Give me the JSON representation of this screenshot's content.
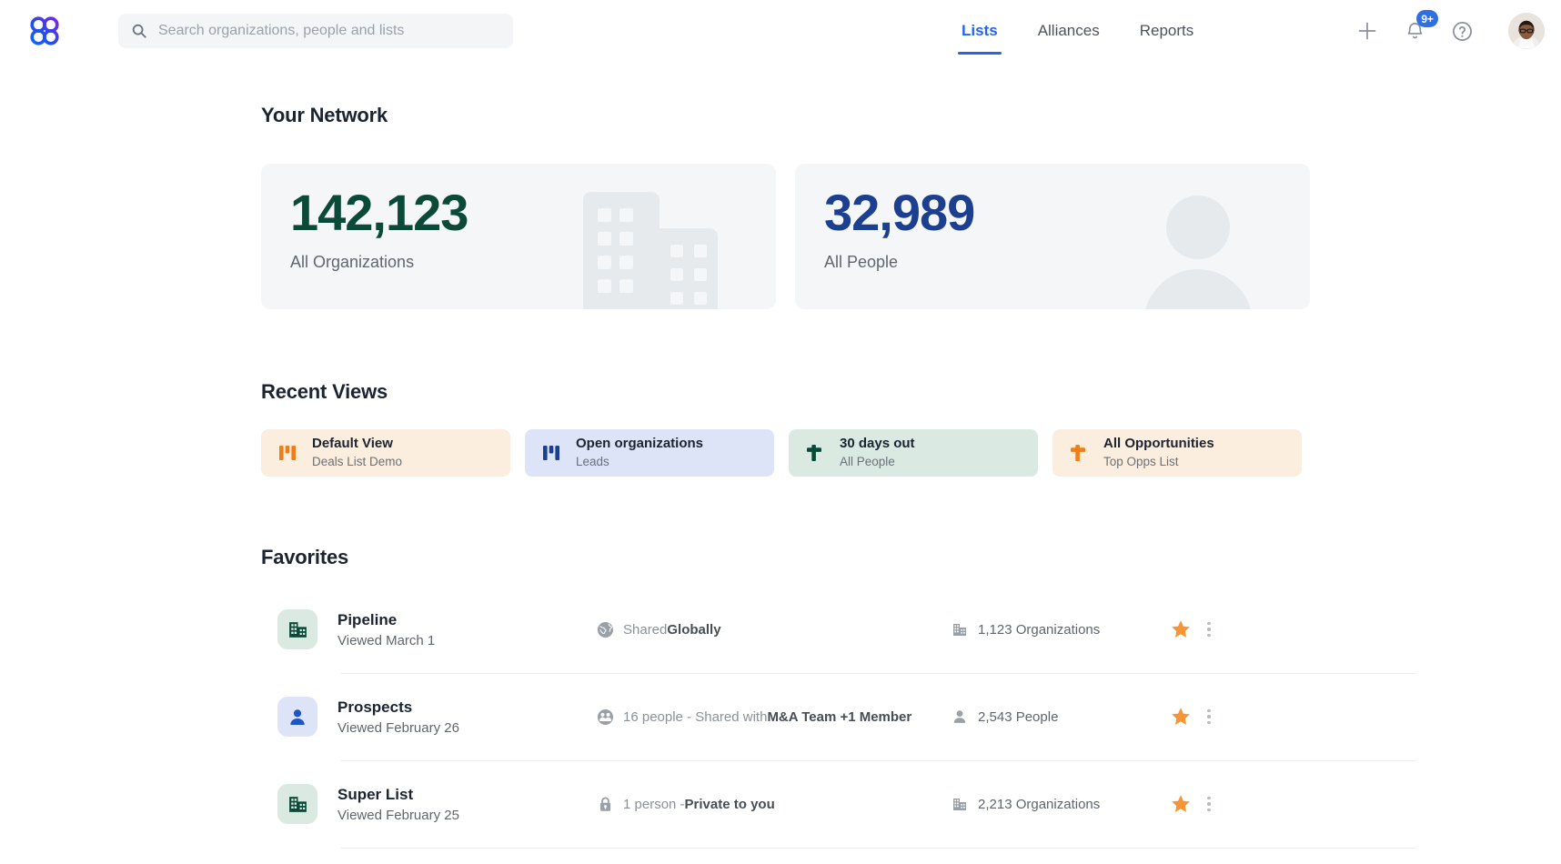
{
  "header": {
    "logo_icon": "affinity-clover-logo",
    "logo_gradient_from": "#1668f0",
    "logo_gradient_to": "#8b1fe0",
    "search": {
      "icon": "search-icon",
      "placeholder": "Search organizations, people and lists",
      "value": ""
    },
    "nav": [
      {
        "label": "Lists",
        "active": true
      },
      {
        "label": "Alliances",
        "active": false
      },
      {
        "label": "Reports",
        "active": false
      }
    ],
    "actions": {
      "add_icon": "plus-icon",
      "notifications_icon": "bell-icon",
      "notifications_badge": "9+",
      "help_icon": "question-circle-icon",
      "avatar_icon": "user-avatar"
    },
    "accent_color": "#2563eb"
  },
  "network": {
    "title": "Your Network",
    "cards": [
      {
        "value": "142,123",
        "label": "All Organizations",
        "color": "#0b4a38",
        "art": "building-illustration"
      },
      {
        "value": "32,989",
        "label": "All People",
        "color": "#1c3f8f",
        "art": "person-illustration"
      }
    ]
  },
  "recent_views": {
    "title": "Recent Views",
    "items": [
      {
        "title": "Default View",
        "subtitle": "Deals List Demo",
        "icon": "kanban-board-icon",
        "bg": "#fceedf",
        "icon_color": "#ef7e17"
      },
      {
        "title": "Open organizations",
        "subtitle": "Leads",
        "icon": "kanban-board-icon",
        "bg": "#dde4f7",
        "icon_color": "#1e3f8f"
      },
      {
        "title": "30 days out",
        "subtitle": "All People",
        "icon": "kanban-rotated-icon",
        "bg": "#daeae2",
        "icon_color": "#0b4a38"
      },
      {
        "title": "All Opportunities",
        "subtitle": "Top Opps List",
        "icon": "kanban-rotated-icon",
        "bg": "#fceedf",
        "icon_color": "#ef7e17"
      }
    ]
  },
  "favorites": {
    "title": "Favorites",
    "rows": [
      {
        "name": "Pipeline",
        "viewed": "Viewed March 1",
        "type_icon": "organization-icon",
        "type_bg": "#daeae2",
        "type_color": "#0b4a38",
        "share_icon": "globe-icon",
        "share_prefix": "Shared ",
        "share_strong": "Globally",
        "count_icon": "organization-small-icon",
        "count": "1,123 Organizations",
        "starred": true,
        "star_icon": "star-filled-icon",
        "menu_icon": "kebab-menu-icon"
      },
      {
        "name": "Prospects",
        "viewed": "Viewed February 26",
        "type_icon": "person-icon",
        "type_bg": "#dde4f7",
        "type_color": "#1e56c4",
        "share_icon": "people-group-icon",
        "share_prefix": "16 people - Shared with ",
        "share_strong": "M&A Team +1 Member",
        "count_icon": "person-small-icon",
        "count": "2,543 People",
        "starred": true,
        "star_icon": "star-filled-icon",
        "menu_icon": "kebab-menu-icon"
      },
      {
        "name": "Super List",
        "viewed": "Viewed February 25",
        "type_icon": "organization-icon",
        "type_bg": "#daeae2",
        "type_color": "#0b4a38",
        "share_icon": "lock-icon",
        "share_prefix": "1 person - ",
        "share_strong": "Private to you",
        "count_icon": "organization-small-icon",
        "count": "2,213 Organizations",
        "starred": true,
        "star_icon": "star-filled-icon",
        "menu_icon": "kebab-menu-icon"
      }
    ]
  }
}
